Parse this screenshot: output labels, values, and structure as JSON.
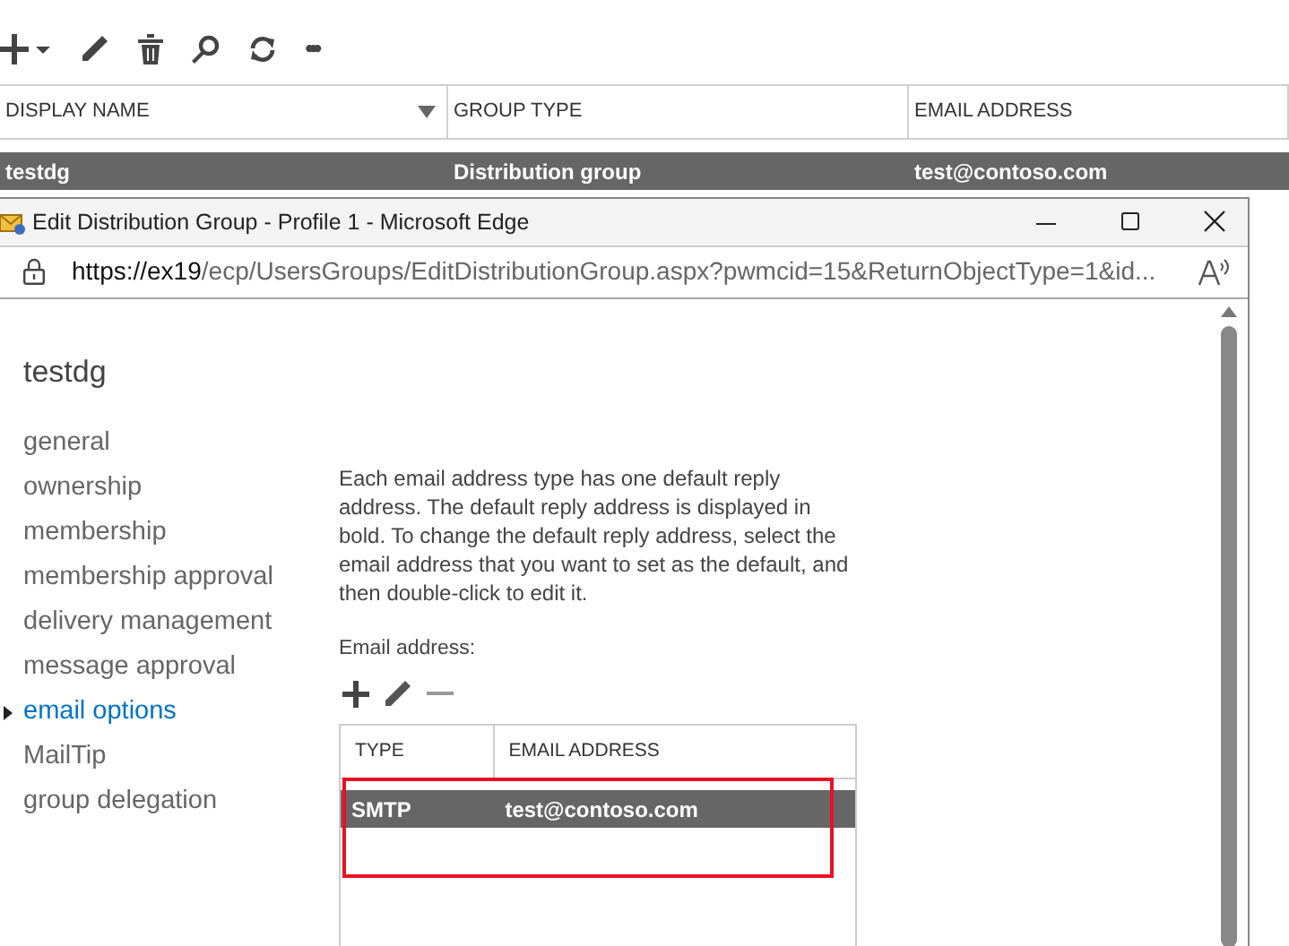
{
  "toolbar": {
    "ellipsis": "•••"
  },
  "groups_table": {
    "columns": [
      {
        "label": "DISPLAY NAME",
        "sorted": true
      },
      {
        "label": "GROUP TYPE",
        "sorted": false
      },
      {
        "label": "EMAIL ADDRESS",
        "sorted": false
      }
    ],
    "rows": [
      {
        "cells": [
          "testdg",
          "Distribution group",
          "test@contoso.com"
        ],
        "selected": true
      }
    ]
  },
  "window": {
    "title": "Edit Distribution Group - Profile 1 - Microsoft Edge",
    "url_host": "https://ex19",
    "url_path": "/ecp/UsersGroups/EditDistributionGroup.aspx?pwmcid=15&ReturnObjectType=1&id...",
    "heading": "testdg",
    "nav": [
      {
        "label": "general",
        "selected": false
      },
      {
        "label": "ownership",
        "selected": false
      },
      {
        "label": "membership",
        "selected": false
      },
      {
        "label": "membership approval",
        "selected": false
      },
      {
        "label": "delivery management",
        "selected": false
      },
      {
        "label": "message approval",
        "selected": false
      },
      {
        "label": "email options",
        "selected": true
      },
      {
        "label": "MailTip",
        "selected": false
      },
      {
        "label": "group delegation",
        "selected": false
      }
    ],
    "description": "Each email address type has one default reply address. The default reply address is displayed in bold. To change the default reply address, select the email address that you want to set as the default, and then double-click to edit it.",
    "email_label": "Email address:",
    "email_table": {
      "columns": [
        "TYPE",
        "EMAIL ADDRESS"
      ],
      "rows": [
        {
          "type": "SMTP",
          "address": "test@contoso.com",
          "selected": true
        }
      ]
    }
  }
}
